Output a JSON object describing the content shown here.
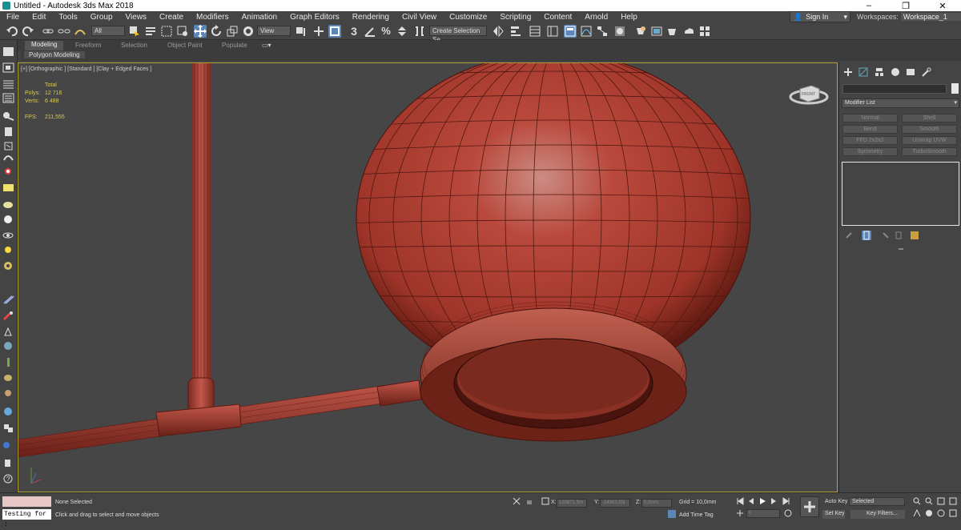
{
  "title": "Untitled - Autodesk 3ds Max 2018",
  "window_controls": [
    "–",
    "❐",
    "✕"
  ],
  "menu": [
    "File",
    "Edit",
    "Tools",
    "Group",
    "Views",
    "Create",
    "Modifiers",
    "Animation",
    "Graph Editors",
    "Rendering",
    "Civil View",
    "Customize",
    "Scripting",
    "Content",
    "Arnold",
    "Help"
  ],
  "signin": "Sign In",
  "workspaces_label": "Workspaces:",
  "workspace_value": "Workspace_1",
  "toolbar": {
    "filter_all": "All",
    "ref_coord": "View",
    "snap_3": "3",
    "named_selection": "Create Selection Se"
  },
  "ribbon": {
    "tabs": [
      "Modeling",
      "Freeform",
      "Selection",
      "Object Paint",
      "Populate"
    ],
    "sub_label": "Polygon Modeling"
  },
  "viewport": {
    "label": "[+] [Orthographic ] [Standard ] [Clay + Edged Faces ]",
    "stats": {
      "total_label": "Total",
      "polys_label": "Polys:",
      "polys_value": "12 716",
      "verts_label": "Verts:",
      "verts_value": "6 488",
      "fps_label": "FPS:",
      "fps_value": "211,555"
    },
    "viewcube_label": "FRONT"
  },
  "command_panel": {
    "modifier_list": "Modifier List",
    "modifiers": [
      "Normal",
      "Shell",
      "Bend",
      "Smooth",
      "FFD 2x2x2",
      "Unwrap UVW",
      "Symmetry",
      "TurboSmooth"
    ]
  },
  "status": {
    "selection": "None Selected",
    "prompt": "Click and drag to select and move objects",
    "script_text": "Testing for :",
    "x_label": "X:",
    "x_value": "130871,5m",
    "y_label": "Y:",
    "y_value": "-14363,55l",
    "z_label": "Z:",
    "z_value": "0,0mm",
    "grid": "Grid = 10,0mm",
    "add_time_tag": "Add Time Tag",
    "auto_key": "Auto Key",
    "set_key": "Set Key",
    "selected": "Selected",
    "key_filters": "Key Filters...",
    "frame": "0"
  },
  "colors": {
    "viewport_border": "#b49f33",
    "object_red": "#b23a2c",
    "selected_tool": "#5a86b8"
  }
}
